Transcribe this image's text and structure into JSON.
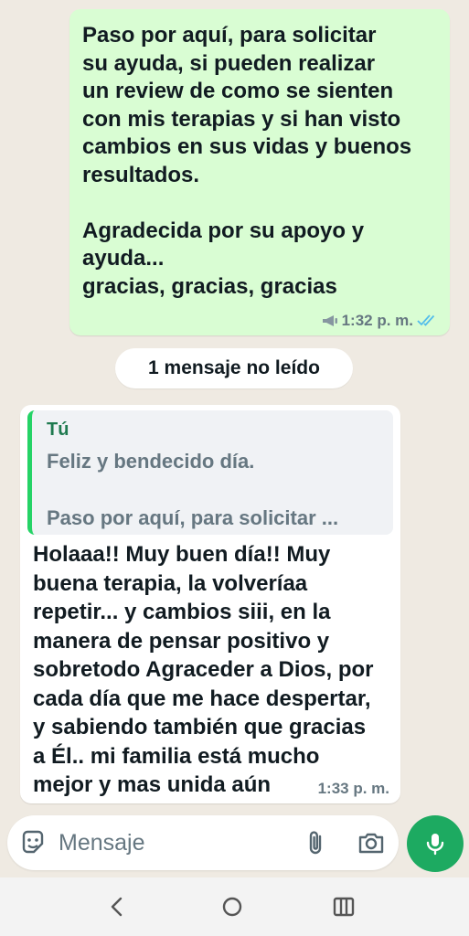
{
  "outgoing_message": {
    "text": "Paso por aquí, para solicitar\nsu ayuda, si pueden realizar\nun review de como se sienten\ncon mis terapias y si han visto\ncambios en sus vidas y buenos\nresultados.\n\nAgradecida por su apoyo y\nayuda...\ngracias, gracias, gracias",
    "time": "1:32 p. m.",
    "broadcast_icon": "megaphone-icon",
    "status_icon": "double-check-read-icon"
  },
  "unread_banner": {
    "label": "1 mensaje no leído"
  },
  "incoming_message": {
    "quote": {
      "author": "Tú",
      "line1": "Feliz y bendecido día.",
      "line2": "Paso por aquí, para solicitar ..."
    },
    "text": "Holaaa!! Muy buen día!! Muy\nbuena terapia, la volveríaa\nrepetir... y cambios siii, en la\nmanera de pensar positivo y\nsobretodo Agraceder a Dios, por\ncada día que me hace despertar,\ny sabiendo también que gracias\na Él.. mi familia está mucho\nmejor y mas unida aún",
    "time": "1:33 p. m."
  },
  "composer": {
    "placeholder": "Mensaje",
    "icons": [
      "sticker-icon",
      "attach-icon",
      "camera-icon",
      "microphone-icon"
    ]
  },
  "navigation": {
    "icons": [
      "back-icon",
      "home-icon",
      "recents-icon"
    ]
  },
  "colors": {
    "chat_background": "#efeae2",
    "outgoing_bubble": "#d9fdd3",
    "incoming_bubble": "#ffffff",
    "accent_green": "#1daa61",
    "read_tick_blue": "#53bdeb"
  }
}
